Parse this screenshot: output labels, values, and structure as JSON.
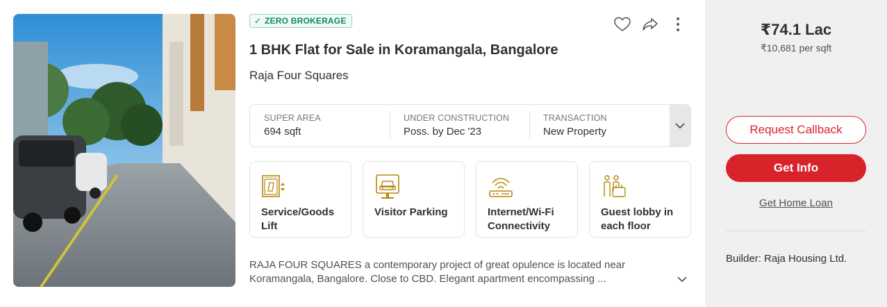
{
  "listing": {
    "badge": "ZERO BROKERAGE",
    "title": "1 BHK Flat for Sale in Koramangala, Bangalore",
    "project": "Raja Four Squares",
    "actions": {
      "favorite_icon": "heart-icon",
      "share_icon": "share-icon",
      "more_icon": "more-vertical-icon"
    },
    "summary": [
      {
        "label": "SUPER AREA",
        "value": "694 sqft"
      },
      {
        "label": "UNDER CONSTRUCTION",
        "value": "Poss. by Dec '23"
      },
      {
        "label": "TRANSACTION",
        "value": "New Property"
      }
    ],
    "amenities": [
      {
        "label": "Service/Goods Lift",
        "icon": "lift-icon"
      },
      {
        "label": "Visitor Parking",
        "icon": "parking-car-icon"
      },
      {
        "label": "Internet/Wi-Fi Connectivity",
        "icon": "wifi-router-icon"
      },
      {
        "label": "Guest lobby in each floor",
        "icon": "guest-lobby-icon"
      }
    ],
    "description": {
      "line1": "RAJA FOUR SQUARES a contemporary project of great opulence is located near",
      "line2": "Koramangala, Bangalore. Close to CBD. Elegant apartment encompassing ..."
    }
  },
  "pricing": {
    "price": "₹74.1 Lac",
    "per_sqft": "₹10,681 per sqft"
  },
  "cta": {
    "callback": "Request Callback",
    "info": "Get Info",
    "loan": "Get Home Loan"
  },
  "builder": "Builder: Raja Housing Ltd.",
  "colors": {
    "accent": "#d8232a",
    "badge_green": "#0f8a5f",
    "amenity_gold": "#b8860b"
  }
}
